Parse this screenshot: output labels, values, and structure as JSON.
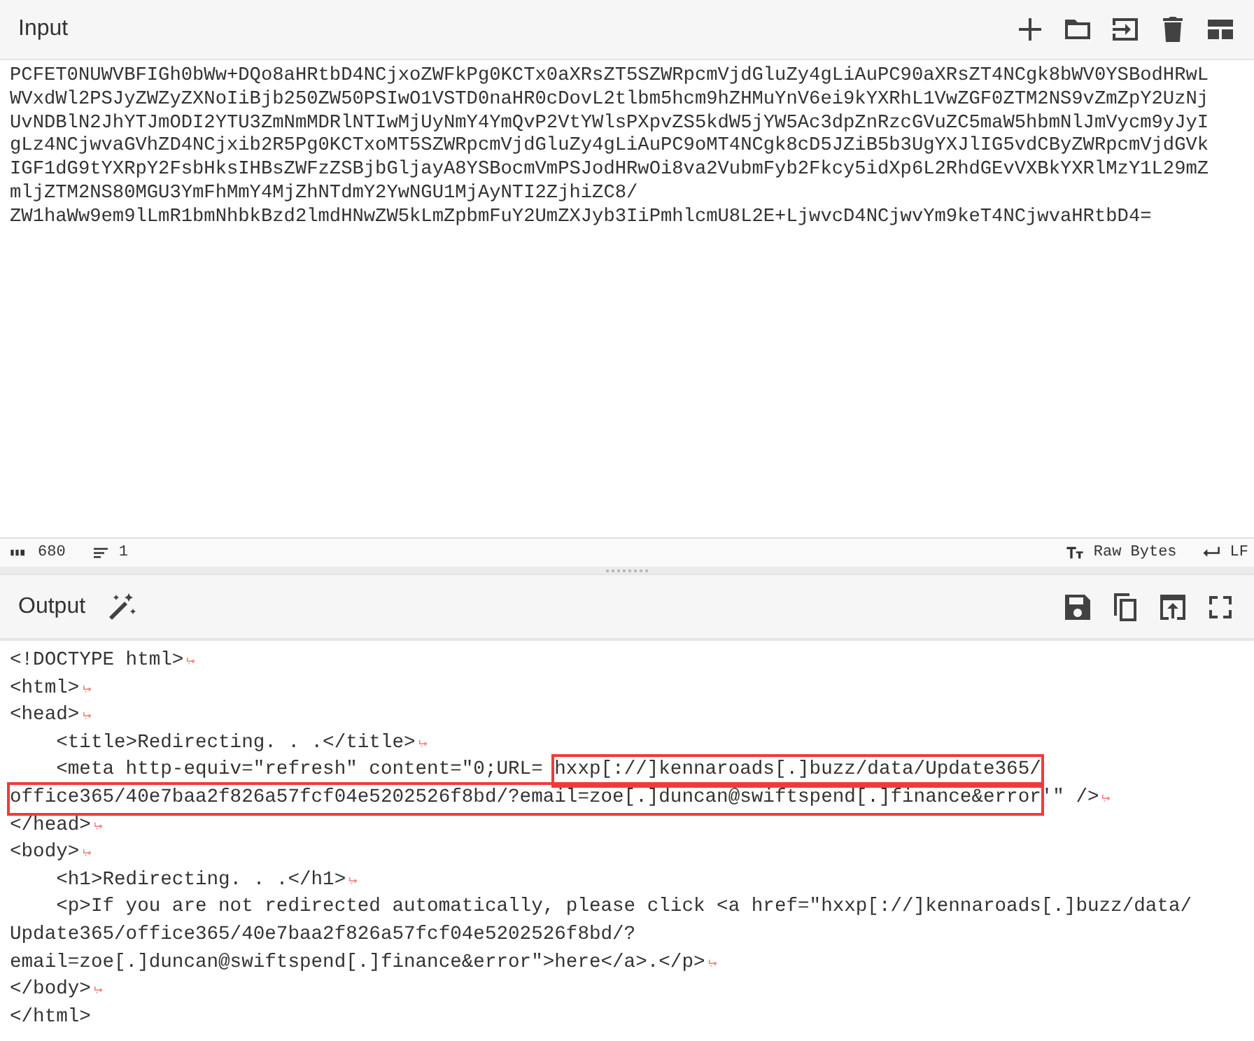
{
  "input": {
    "title": "Input",
    "lines": [
      "PCFET0NUWVBFIGh0bWw+DQo8aHRtbD4NCjxoZWFkPg0KCTx0aXRsZT5SZWRpcmVjdGluZy4gLiAuPC90aXRsZT4NCgk8bWV0YSBodHRwL",
      "WVxdWl2PSJyZWZyZXNoIiBjb250ZW50PSIwO1VSTD0naHR0cDovL2tlbm5hcm9hZHMuYnV6ei9kYXRhL1VwZGF0ZTM2NS9vZmZpY2UzNj",
      "UvNDBlN2JhYTJmODI2YTU3ZmNmMDRlNTIwMjUyNmY4YmQvP2VtYWlsPXpvZS5kdW5jYW5Ac3dpZnRzcGVuZC5maW5hbmNlJmVycm9yJyI",
      "gLz4NCjwvaGVhZD4NCjxib2R5Pg0KCTxoMT5SZWRpcmVjdGluZy4gLiAuPC9oMT4NCgk8cD5JZiB5b3UgYXJlIG5vdCByZWRpcmVjdGVk",
      "IGF1dG9tYXRpY2FsbHksIHBsZWFzZSBjbGljayA8YSBocmVmPSJodHRwOi8va2VubmFyb2Fkcy5idXp6L2RhdGEvVXBkYXRlMzY1L29mZ",
      "mljZTM2NS80MGU3YmFhMmY4MjZhNTdmY2YwNGU1MjAyNTI2ZjhiZC8/",
      "ZW1haWw9em9lLmR1bmNhbkBzd2lmdHNwZW5kLmZpbmFuY2UmZXJyb3IiPmhlcmU8L2E+LjwvcD4NCjwvYm9keT4NCjwvaHRtbD4="
    ],
    "length": "680",
    "line_count": "1",
    "encoding": "Raw Bytes",
    "eol": "LF"
  },
  "output": {
    "title": "Output",
    "rows": [
      {
        "parts": [
          {
            "text": "<!DOCTYPE html>",
            "highlighted": false
          }
        ],
        "eol": true
      },
      {
        "parts": [
          {
            "text": "<html>",
            "highlighted": false
          }
        ],
        "eol": true
      },
      {
        "parts": [
          {
            "text": "<head>",
            "highlighted": false
          }
        ],
        "eol": true
      },
      {
        "parts": [
          {
            "text": "    <title>Redirecting. . .</title>",
            "highlighted": false
          }
        ],
        "eol": true
      },
      {
        "parts": [
          {
            "text": "    <meta http-equiv=\"refresh\" content=\"0;URL= ",
            "highlighted": false
          },
          {
            "text": "hxxp[://]kennaroads[.]buzz/data/Update365/",
            "highlighted": true
          }
        ],
        "eol": false
      },
      {
        "parts": [
          {
            "text": "office365/40e7baa2f826a57fcf04e5202526f8bd/?email=zoe[.]duncan@swiftspend[.]finance&error",
            "highlighted": true
          },
          {
            "text": "'\" />",
            "highlighted": false
          }
        ],
        "eol": true
      },
      {
        "parts": [
          {
            "text": "</head>",
            "highlighted": false
          }
        ],
        "eol": true
      },
      {
        "parts": [
          {
            "text": "<body>",
            "highlighted": false
          }
        ],
        "eol": true
      },
      {
        "parts": [
          {
            "text": "    <h1>Redirecting. . .</h1>",
            "highlighted": false
          }
        ],
        "eol": true
      },
      {
        "parts": [
          {
            "text": "    <p>If you are not redirected automatically, please click <a href=\"hxxp[://]kennaroads[.]buzz/data/",
            "highlighted": false
          }
        ],
        "eol": false
      },
      {
        "parts": [
          {
            "text": "Update365/office365/40e7baa2f826a57fcf04e5202526f8bd/?",
            "highlighted": false
          }
        ],
        "eol": false
      },
      {
        "parts": [
          {
            "text": "email=zoe[.]duncan@swiftspend[.]finance&error\">here</a>.</p>",
            "highlighted": false
          }
        ],
        "eol": true
      },
      {
        "parts": [
          {
            "text": "</body>",
            "highlighted": false
          }
        ],
        "eol": true
      },
      {
        "parts": [
          {
            "text": "</html>",
            "highlighted": false
          }
        ],
        "eol": false
      }
    ]
  }
}
